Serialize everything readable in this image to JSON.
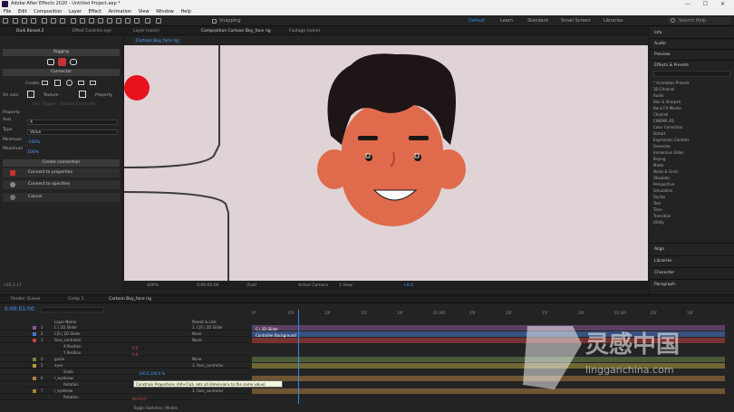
{
  "window": {
    "title": "Adobe After Effects 2020 - Untitled Project.aep *",
    "buttons": "— ☐ ✕"
  },
  "menu": [
    "File",
    "Edit",
    "Composition",
    "Layer",
    "Effect",
    "Animation",
    "View",
    "Window",
    "Help"
  ],
  "toolbar": {
    "snapping": "Snapping",
    "workspaces": [
      "Default",
      "Learn",
      "Standard",
      "Small Screen",
      "Libraries"
    ],
    "search_placeholder": "Search Help"
  },
  "left_panel": {
    "tabs": [
      "Duik Bassel.2",
      "Effect Controls eye"
    ],
    "header": "Rigging",
    "section_connector": "Connector",
    "create_label": "Create:",
    "on_axis": "On axis:",
    "texture": "Texture",
    "property": "Property",
    "dimmed_text": "Use Trigger / Texture Controller",
    "property_label": "Property",
    "axis_label": "Axis",
    "axis_value": "X",
    "type_label": "Type",
    "type_value": "Value",
    "minimum_label": "Minimum",
    "minimum_value": "-100%",
    "maximum_label": "Maximum",
    "maximum_value": "100%",
    "section_connection": "Create connection",
    "btn_properties": "Connect to properties",
    "btn_opacities": "Connect to opacities",
    "btn_cancel": "Cancel",
    "version": "v16.2.17"
  },
  "comp_panel": {
    "tabs": [
      "Layer (none)",
      "Composition Cartoon Boy_face rig",
      "Footage (none)"
    ],
    "subtab": "Cartoon Boy_face rig",
    "footer": {
      "zoom": "400%",
      "timecode": "0:00:01:00",
      "res": "(Full)",
      "camera": "Active Camera",
      "view": "1 View",
      "exposure": "+0.0"
    }
  },
  "right_panel": {
    "sections": [
      "Info",
      "Audio",
      "Preview",
      "Effects & Presets"
    ],
    "effects": [
      "* Animation Presets",
      "3D Channel",
      "Audio",
      "Blur & Sharpen",
      "Boris FX Mocha",
      "Channel",
      "CINEMA 4D",
      "Color Correction",
      "Distort",
      "Expression Controls",
      "Generate",
      "Immersive Video",
      "Keying",
      "Matte",
      "Noise & Grain",
      "Obsolete",
      "Perspective",
      "Simulation",
      "Stylize",
      "Text",
      "Time",
      "Transition",
      "Utility"
    ],
    "lower_sections": [
      "Align",
      "Libraries",
      "Character",
      "Paragraph"
    ]
  },
  "timeline": {
    "tabs": [
      "Render Queue",
      "Comp 1",
      "Cartoon Boy_face rig"
    ],
    "timecode": "0:00:01:00",
    "col_layer": "Layer Name",
    "col_parent": "Parent & Link",
    "ruler": [
      "0f",
      "05f",
      "10f",
      "15f",
      "20f",
      "01:00f",
      "05f",
      "10f",
      "15f",
      "20f",
      "02:00f",
      "05f",
      "10f"
    ],
    "layers": [
      {
        "num": "1",
        "name": "C | 2D Slider",
        "parent": "1. C|S | 2D Slider",
        "color": "#8a5a9a"
      },
      {
        "num": "2",
        "name": "C|S | 2D Slider",
        "parent": "None",
        "color": "#4a7ad0"
      },
      {
        "num": "3",
        "name": "face_controller",
        "parent": "None",
        "color": "#c04040"
      },
      {
        "num": "",
        "name": "X Position",
        "parent": "",
        "color": ""
      },
      {
        "num": "",
        "name": "Y Position",
        "parent": "",
        "color": ""
      },
      {
        "num": "4",
        "name": "guide",
        "parent": "None",
        "color": "#6a8a4a"
      },
      {
        "num": "5",
        "name": "eyes",
        "parent": "3. face_controller",
        "color": "#b0a040"
      },
      {
        "num": "",
        "name": "Scale",
        "parent": "",
        "color": ""
      },
      {
        "num": "6",
        "name": "r_eyebrow",
        "parent": "",
        "color": "#b08040"
      },
      {
        "num": "",
        "name": "Rotation",
        "parent": "",
        "color": ""
      },
      {
        "num": "7",
        "name": "l_eyebrow",
        "parent": "3. face_controller",
        "color": "#b08040"
      },
      {
        "num": "",
        "name": "Rotation",
        "parent": "",
        "color": ""
      }
    ],
    "bar_labels": [
      "C | 2D Slider",
      "Controller Background"
    ],
    "values": {
      "x_pos": "0.0",
      "y_pos": "0.0",
      "scale": "100.0,100.0 %",
      "rot": "0x+0.0°"
    },
    "footer": "Toggle Switches / Modes",
    "tooltip": "Constrain Proportions (Alt+Click sets all dimensions to the same value)"
  },
  "watermark": {
    "cn": "灵感中国",
    "url": "lingganchina.com"
  }
}
